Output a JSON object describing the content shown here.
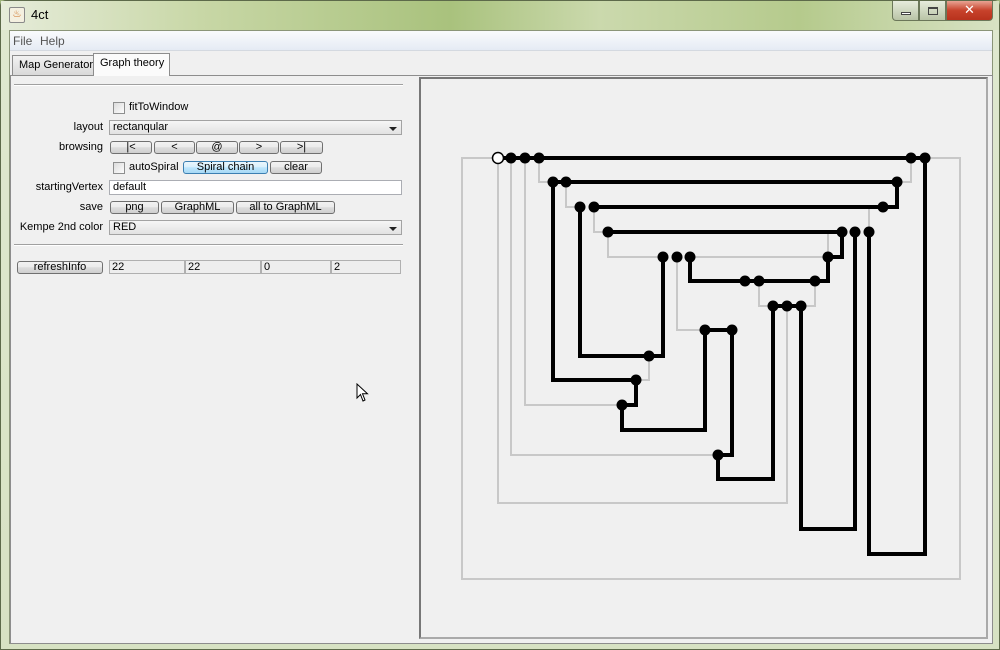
{
  "window": {
    "title": "4ct",
    "app_icon": "java-cup-icon",
    "controls": [
      "minimize",
      "maximize",
      "close"
    ]
  },
  "menubar": {
    "items": [
      {
        "label": "File"
      },
      {
        "label": "Help"
      }
    ]
  },
  "tabs": [
    {
      "label": "Map Generator",
      "active": false
    },
    {
      "label": "Graph theory",
      "active": true
    }
  ],
  "controls": {
    "fit_to_window": {
      "label": "fitToWindow",
      "checked": false
    },
    "layout": {
      "label": "layout",
      "value": "rectanqular"
    },
    "browsing": {
      "label": "browsing",
      "buttons": [
        "|<",
        "<",
        "@",
        ">",
        ">|"
      ]
    },
    "auto_spiral": {
      "label": "autoSpiral",
      "checked": false
    },
    "spiral_chain_button": "Spiral chain",
    "clear_button": "clear",
    "starting_vertex": {
      "label": "startingVertex",
      "value": "default"
    },
    "save": {
      "label": "save",
      "buttons": [
        "png",
        "GraphML",
        "all to GraphML"
      ]
    },
    "kempe_color": {
      "label": "Kempe 2nd color",
      "value": "RED"
    },
    "refresh_info_button": "refreshInfo",
    "info_values": [
      "22",
      "22",
      "0",
      "2"
    ]
  },
  "graph": {
    "colors": {
      "primary_edge": "#000000",
      "secondary_edge": "#c8c8c8",
      "vertex_fill": "#000000",
      "start_vertex_fill": "#ffffff"
    },
    "vertex_count": 32,
    "start_vertex": 0
  }
}
